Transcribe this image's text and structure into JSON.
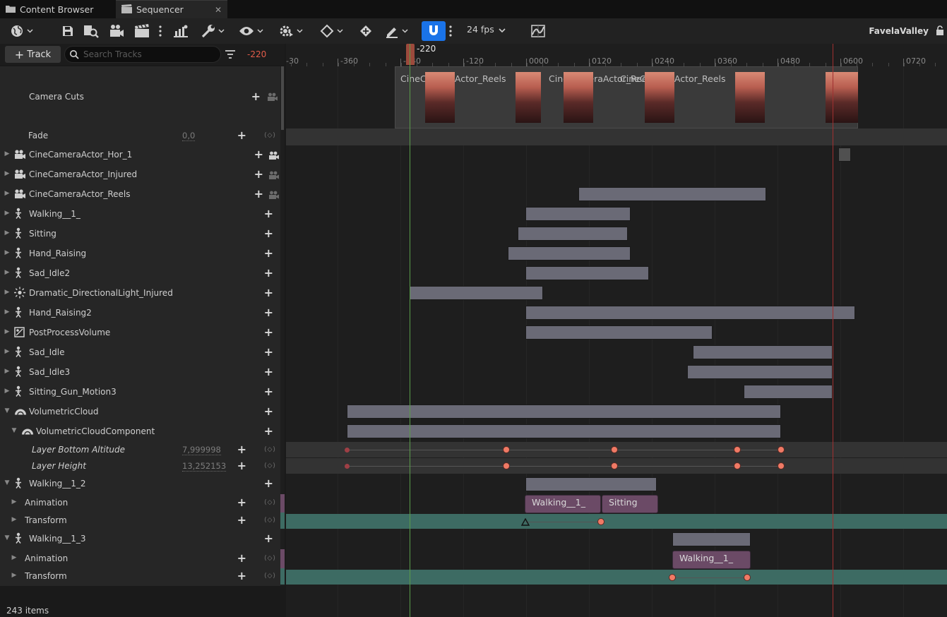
{
  "tabs": [
    {
      "label": "Content Browser",
      "icon": "folder-icon"
    },
    {
      "label": "Sequencer",
      "icon": "clapperboard-icon",
      "active": true
    }
  ],
  "toolbar": {
    "fps": "24 fps",
    "project": "FavelaValley"
  },
  "left_toolbar": {
    "add_track_label": "Track",
    "search_placeholder": "Search Tracks",
    "current_frame": "-220"
  },
  "ruler": {
    "playhead_label": "-220",
    "ticks": [
      "-30",
      "-360",
      "-240",
      "-120",
      "0000",
      "0120",
      "0240",
      "0360",
      "0480",
      "0600",
      "0720"
    ]
  },
  "camera_cuts": {
    "label": "Camera Cuts",
    "segments": [
      "CineCameraActor_Reels",
      "CineCameraActor_Reels",
      "CineCameraActor_Reels"
    ]
  },
  "tracks": [
    {
      "id": "fade",
      "label": "Fade",
      "value": "0,0",
      "icon": "none"
    },
    {
      "id": "cam-hor",
      "label": "CineCameraActor_Hor_1",
      "icon": "camera-actor-icon"
    },
    {
      "id": "cam-injured",
      "label": "CineCameraActor_Injured",
      "icon": "camera-actor-icon"
    },
    {
      "id": "cam-reels",
      "label": "CineCameraActor_Reels",
      "icon": "camera-actor-icon"
    },
    {
      "id": "walking1",
      "label": "Walking__1_",
      "icon": "skeleton-icon"
    },
    {
      "id": "sitting",
      "label": "Sitting",
      "icon": "skeleton-icon"
    },
    {
      "id": "hand-raising",
      "label": "Hand_Raising",
      "icon": "skeleton-icon"
    },
    {
      "id": "sad-idle2",
      "label": "Sad_Idle2",
      "icon": "skeleton-icon"
    },
    {
      "id": "dir-light",
      "label": "Dramatic_DirectionalLight_Injured",
      "icon": "light-icon"
    },
    {
      "id": "hand-raising2",
      "label": "Hand_Raising2",
      "icon": "skeleton-icon"
    },
    {
      "id": "ppv",
      "label": "PostProcessVolume",
      "icon": "postprocess-icon"
    },
    {
      "id": "sad-idle",
      "label": "Sad_Idle",
      "icon": "skeleton-icon"
    },
    {
      "id": "sad-idle3",
      "label": "Sad_Idle3",
      "icon": "skeleton-icon"
    },
    {
      "id": "sitting-gun",
      "label": "Sitting_Gun_Motion3",
      "icon": "skeleton-icon"
    },
    {
      "id": "vol-cloud",
      "label": "VolumetricCloud",
      "icon": "cloud-icon"
    },
    {
      "id": "vol-cloud-comp",
      "label": "VolumetricCloudComponent",
      "icon": "cloud-icon"
    },
    {
      "id": "layer-bottom",
      "label": "Layer Bottom Altitude",
      "value": "7,999998",
      "icon": "none"
    },
    {
      "id": "layer-height",
      "label": "Layer Height",
      "value": "13,252153",
      "icon": "none"
    },
    {
      "id": "walking12",
      "label": "Walking__1_2",
      "icon": "skeleton-icon"
    },
    {
      "id": "w12-anim",
      "label": "Animation",
      "icon": "none"
    },
    {
      "id": "w12-trans",
      "label": "Transform",
      "icon": "none"
    },
    {
      "id": "walking13",
      "label": "Walking__1_3",
      "icon": "skeleton-icon"
    },
    {
      "id": "w13-anim",
      "label": "Animation",
      "icon": "none"
    },
    {
      "id": "w13-trans",
      "label": "Transform",
      "icon": "none"
    }
  ],
  "anim_sections": {
    "w12_a": "Walking__1_",
    "w12_b": "Sitting",
    "w13_a": "Walking__1_"
  },
  "status": {
    "items": "243 items"
  },
  "colors": {
    "accent": "#1a73e8",
    "playhead": "#e25c4a",
    "key": "#f07a65",
    "section": "#6a6a76",
    "anim_section": "#6b4a66",
    "transform_row": "#3d6b63"
  }
}
